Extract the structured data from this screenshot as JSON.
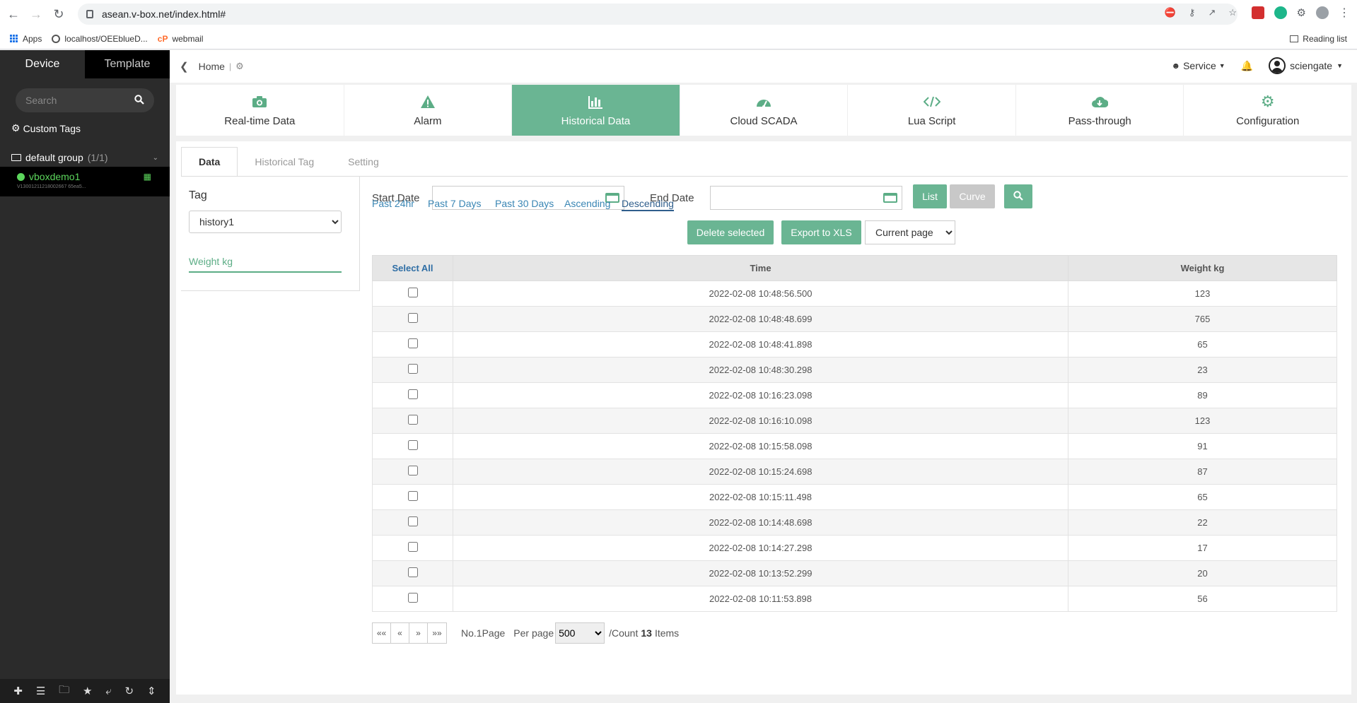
{
  "browser": {
    "url": "asean.v-box.net/index.html#",
    "bookmarks": [
      "Apps",
      "localhost/OEEblueD...",
      "webmail"
    ],
    "reading_list": "Reading list"
  },
  "sidebar": {
    "tabs": [
      "Device",
      "Template"
    ],
    "search_placeholder": "Search",
    "custom_tags": "Custom Tags",
    "group_name": "default group",
    "group_count": "(1/1)",
    "device_name": "vboxdemo1",
    "device_id": "V13001211218002667 65ea5..."
  },
  "header": {
    "home": "Home",
    "service": "Service",
    "user": "sciengate"
  },
  "modules": [
    {
      "label": "Real-time Data",
      "icon": "camera-icon"
    },
    {
      "label": "Alarm",
      "icon": "alarm-icon"
    },
    {
      "label": "Historical Data",
      "icon": "bar-chart-icon"
    },
    {
      "label": "Cloud SCADA",
      "icon": "dashboard-icon"
    },
    {
      "label": "Lua Script",
      "icon": "code-icon"
    },
    {
      "label": "Pass-through",
      "icon": "cloud-download-icon"
    },
    {
      "label": "Configuration",
      "icon": "gear-icon"
    }
  ],
  "subtabs": [
    "Data",
    "Historical Tag",
    "Setting"
  ],
  "tag_panel": {
    "label": "Tag",
    "selected": "history1",
    "field": "Weight kg"
  },
  "controls": {
    "start_date_label": "Start Date",
    "end_date_label": "End Date",
    "list_btn": "List",
    "curve_btn": "Curve",
    "quick_ranges": [
      "Past 24hr",
      "Past 7 Days",
      "Past 30 Days",
      "Ascending",
      "Descending"
    ],
    "delete_btn": "Delete selected",
    "export_btn": "Export to XLS",
    "page_scope": "Current page"
  },
  "table": {
    "headers": [
      "Select All",
      "Time",
      "Weight kg"
    ],
    "rows": [
      [
        "2022-02-08 10:48:56.500",
        "123"
      ],
      [
        "2022-02-08 10:48:48.699",
        "765"
      ],
      [
        "2022-02-08 10:48:41.898",
        "65"
      ],
      [
        "2022-02-08 10:48:30.298",
        "23"
      ],
      [
        "2022-02-08 10:16:23.098",
        "89"
      ],
      [
        "2022-02-08 10:16:10.098",
        "123"
      ],
      [
        "2022-02-08 10:15:58.098",
        "91"
      ],
      [
        "2022-02-08 10:15:24.698",
        "87"
      ],
      [
        "2022-02-08 10:15:11.498",
        "65"
      ],
      [
        "2022-02-08 10:14:48.698",
        "22"
      ],
      [
        "2022-02-08 10:14:27.298",
        "17"
      ],
      [
        "2022-02-08 10:13:52.299",
        "20"
      ],
      [
        "2022-02-08 10:11:53.898",
        "56"
      ]
    ]
  },
  "pager": {
    "buttons": [
      "««",
      "«",
      "»",
      "»»"
    ],
    "page_text": "No.1Page",
    "per_page_label": "Per page",
    "per_page": "500",
    "count_prefix": "/Count",
    "count": "13",
    "count_suffix": "Items"
  }
}
